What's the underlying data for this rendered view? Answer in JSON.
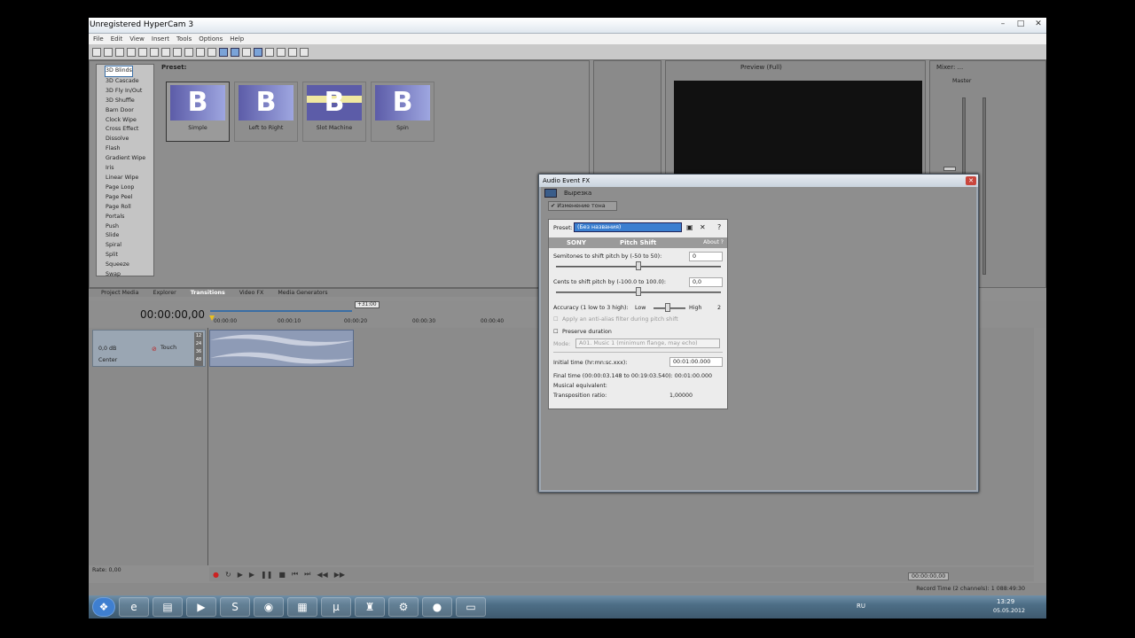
{
  "window": {
    "title": "Unregistered HyperCam 3"
  },
  "menu": [
    "File",
    "Edit",
    "View",
    "Insert",
    "Tools",
    "Options",
    "Help"
  ],
  "preset_label": "Preset:",
  "transitions_list": [
    "3D Blinds",
    "3D Cascade",
    "3D Fly In/Out",
    "3D Shuffle",
    "Barn Door",
    "Clock Wipe",
    "Cross Effect",
    "Dissolve",
    "Flash",
    "Gradient Wipe",
    "Iris",
    "Linear Wipe",
    "Page Loop",
    "Page Peel",
    "Page Roll",
    "Portals",
    "Push",
    "Slide",
    "Spiral",
    "Split",
    "Squeeze",
    "Swap"
  ],
  "thumbnails": [
    {
      "label": "Simple",
      "glyph": "B"
    },
    {
      "label": "Left to Right",
      "glyph": "B"
    },
    {
      "label": "Slot Machine",
      "glyph": "B"
    },
    {
      "label": "Spin",
      "glyph": "B"
    }
  ],
  "tabs": [
    "Project Media",
    "Explorer",
    "Transitions",
    "Video FX",
    "Media Generators"
  ],
  "preview": {
    "label": "Preview (Full)"
  },
  "mixer": {
    "label": "Mixer: ...",
    "master": "Master"
  },
  "timecode": "00:00:00,00",
  "cursor_marker": "+31:00",
  "ruler": [
    "00:00:00",
    "00:00:10",
    "00:00:20",
    "00:00:30",
    "00:00:40"
  ],
  "track": {
    "volume": "0,0 dB",
    "pan": "Center",
    "automation": "Touch",
    "levels": [
      "12",
      "24",
      "36",
      "48"
    ]
  },
  "rate": "Rate: 0,00",
  "transport_time": "00:00:00,00",
  "record_time": "Record Time (2 channels): 1 088:49:30",
  "dialog": {
    "title": "Audio Event FX",
    "chain_item": "Вырезка",
    "fx_tab": "Изменение тона",
    "preset_label": "Preset:",
    "preset_value": "(Без названия)",
    "brand": "SONY",
    "plugin_name": "Pitch Shift",
    "about": "About ?",
    "semitones_label": "Semitones to shift pitch by (-50 to 50):",
    "semitones_value": "0",
    "cents_label": "Cents to shift pitch by (-100.0 to 100.0):",
    "cents_value": "0,0",
    "accuracy_label": "Accuracy (1 low to 3 high):",
    "low": "Low",
    "high": "High",
    "accuracy_value": "2",
    "antialias": "Apply an anti-alias filter during pitch shift",
    "preserve": "Preserve duration",
    "mode_label": "Mode:",
    "mode_value": "A01. Music 1 (minimum flange, may echo)",
    "initial_time_label": "Initial time (hr:mn:sc.xxx):",
    "initial_time_value": "00:01:00.000",
    "final_time": "Final time (00:00:03.148 to 00:19:03.540): 00:01:00.000",
    "musical_eq": "Musical equivalent:",
    "transposition_label": "Transposition ratio:",
    "transposition_value": "1,00000"
  },
  "tray": {
    "lang": "RU",
    "time": "13:29",
    "date": "05.05.2012"
  }
}
